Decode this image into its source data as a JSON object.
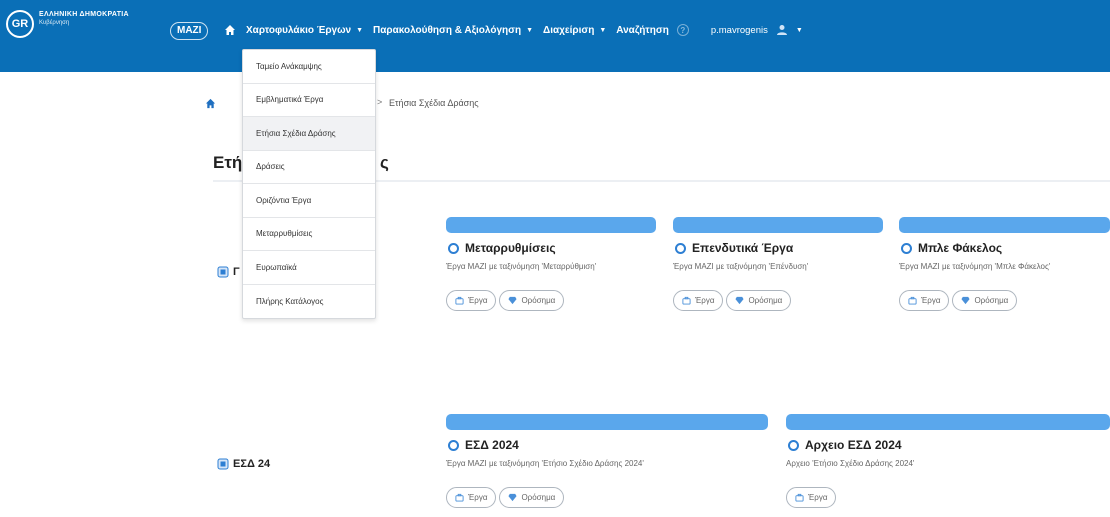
{
  "header": {
    "gov_title": "ΕΛΛΗΝΙΚΗ ΔΗΜΟΚΡΑΤΙΑ",
    "gov_subtitle": "Κυβέρνηση",
    "gov_emblem": "GR",
    "logo_text": "MAZI",
    "nav": [
      {
        "label": "Χαρτοφυλάκιο Έργων"
      },
      {
        "label": "Παρακολούθηση & Αξιολόγηση"
      },
      {
        "label": "Διαχείριση"
      },
      {
        "label": "Αναζήτηση"
      }
    ],
    "caret": "▼",
    "help_glyph": "?",
    "username": "p.mavrogenis"
  },
  "dropdown": {
    "items": [
      "Ταμείο Ανάκαμψης",
      "Εμβληματικά Έργα",
      "Ετήσια Σχέδια Δράσης",
      "Δράσεις",
      "Οριζόντια Έργα",
      "Μεταρρυθμίσεις",
      "Ευρωπαϊκά",
      "Πλήρης Κατάλογος"
    ],
    "active_index": 2
  },
  "breadcrumb": {
    "separator": ">",
    "current": "Ετήσια Σχέδια Δράσης"
  },
  "page": {
    "title_visible_left": "Ετή",
    "title_visible_right": "ς"
  },
  "sections": [
    {
      "label": "Γ"
    },
    {
      "label": "ΕΣΔ 24"
    }
  ],
  "cards": [
    {
      "title": "Μεταρρυθμίσεις",
      "desc": "Έργα MAZI με ταξινόμηση 'Μεταρρύθμιση'",
      "chips": [
        "Έργα",
        "Ορόσημα"
      ]
    },
    {
      "title": "Επενδυτικά Έργα",
      "desc": "Έργα MAZI με ταξινόμηση 'Επένδυση'",
      "chips": [
        "Έργα",
        "Ορόσημα"
      ]
    },
    {
      "title": "Μπλε Φάκελος",
      "desc": "Έργα MAZI με ταξινόμηση 'Μπλε Φάκελος'",
      "chips": [
        "Έργα",
        "Ορόσημα"
      ]
    },
    {
      "title": "ΕΣΔ 2024",
      "desc": "Έργα MAZI με ταξινόμηση 'Ετήσιο Σχέδιο Δράσης 2024'",
      "chips": [
        "Έργα",
        "Ορόσημα"
      ]
    },
    {
      "title": "Αρχειο ΕΣΔ 2024",
      "desc": "Αρχειο 'Ετήσιο Σχέδιο Δράσης 2024'",
      "chips": [
        "Έργα"
      ]
    }
  ],
  "colors": {
    "header_bg": "#0a6fb7",
    "card_bar": "#5aa7ec",
    "accent": "#2d7fd3"
  },
  "icons": {
    "home": "home-icon",
    "user": "user-icon",
    "folder": "folder-icon",
    "card": "circle-icon",
    "works_chip": "briefcase-icon",
    "milestones_chip": "diamond-icon"
  }
}
